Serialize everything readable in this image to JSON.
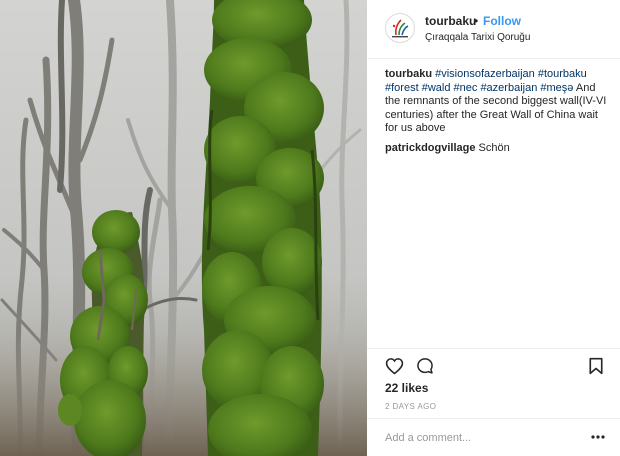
{
  "post": {
    "image_alt_subject": "moss-covered-trees",
    "colors": {
      "fog": "#c8c9c6",
      "moss": "#4f7a1e",
      "link": "#3897f0",
      "hashtag": "#003569"
    }
  },
  "header": {
    "username": "tourbaku",
    "separator": "•",
    "follow_label": "Follow",
    "location": "Çıraqqala Tarixi Qoruğu",
    "avatar_icon": "tourbaku-logo-icon"
  },
  "caption": {
    "username": "tourbaku",
    "tags": [
      "#visionsofazerbaijan",
      "#tourbaku",
      "#forest",
      "#wald",
      "#nec",
      "#azerbaijan",
      "#meşə"
    ],
    "text": "And the remnants of the second biggest wall(IV-VI centuries) after the Great Wall of China wait for us above"
  },
  "comments": [
    {
      "username": "patrickdogvillage",
      "text": "Schön"
    }
  ],
  "actions": {
    "like_icon": "heart-icon",
    "comment_icon": "comment-bubble-icon",
    "save_icon": "bookmark-icon"
  },
  "likes": "22 likes",
  "timestamp": "2 DAYS AGO",
  "add_comment": {
    "placeholder": "Add a comment...",
    "more_icon": "more-options-icon"
  }
}
